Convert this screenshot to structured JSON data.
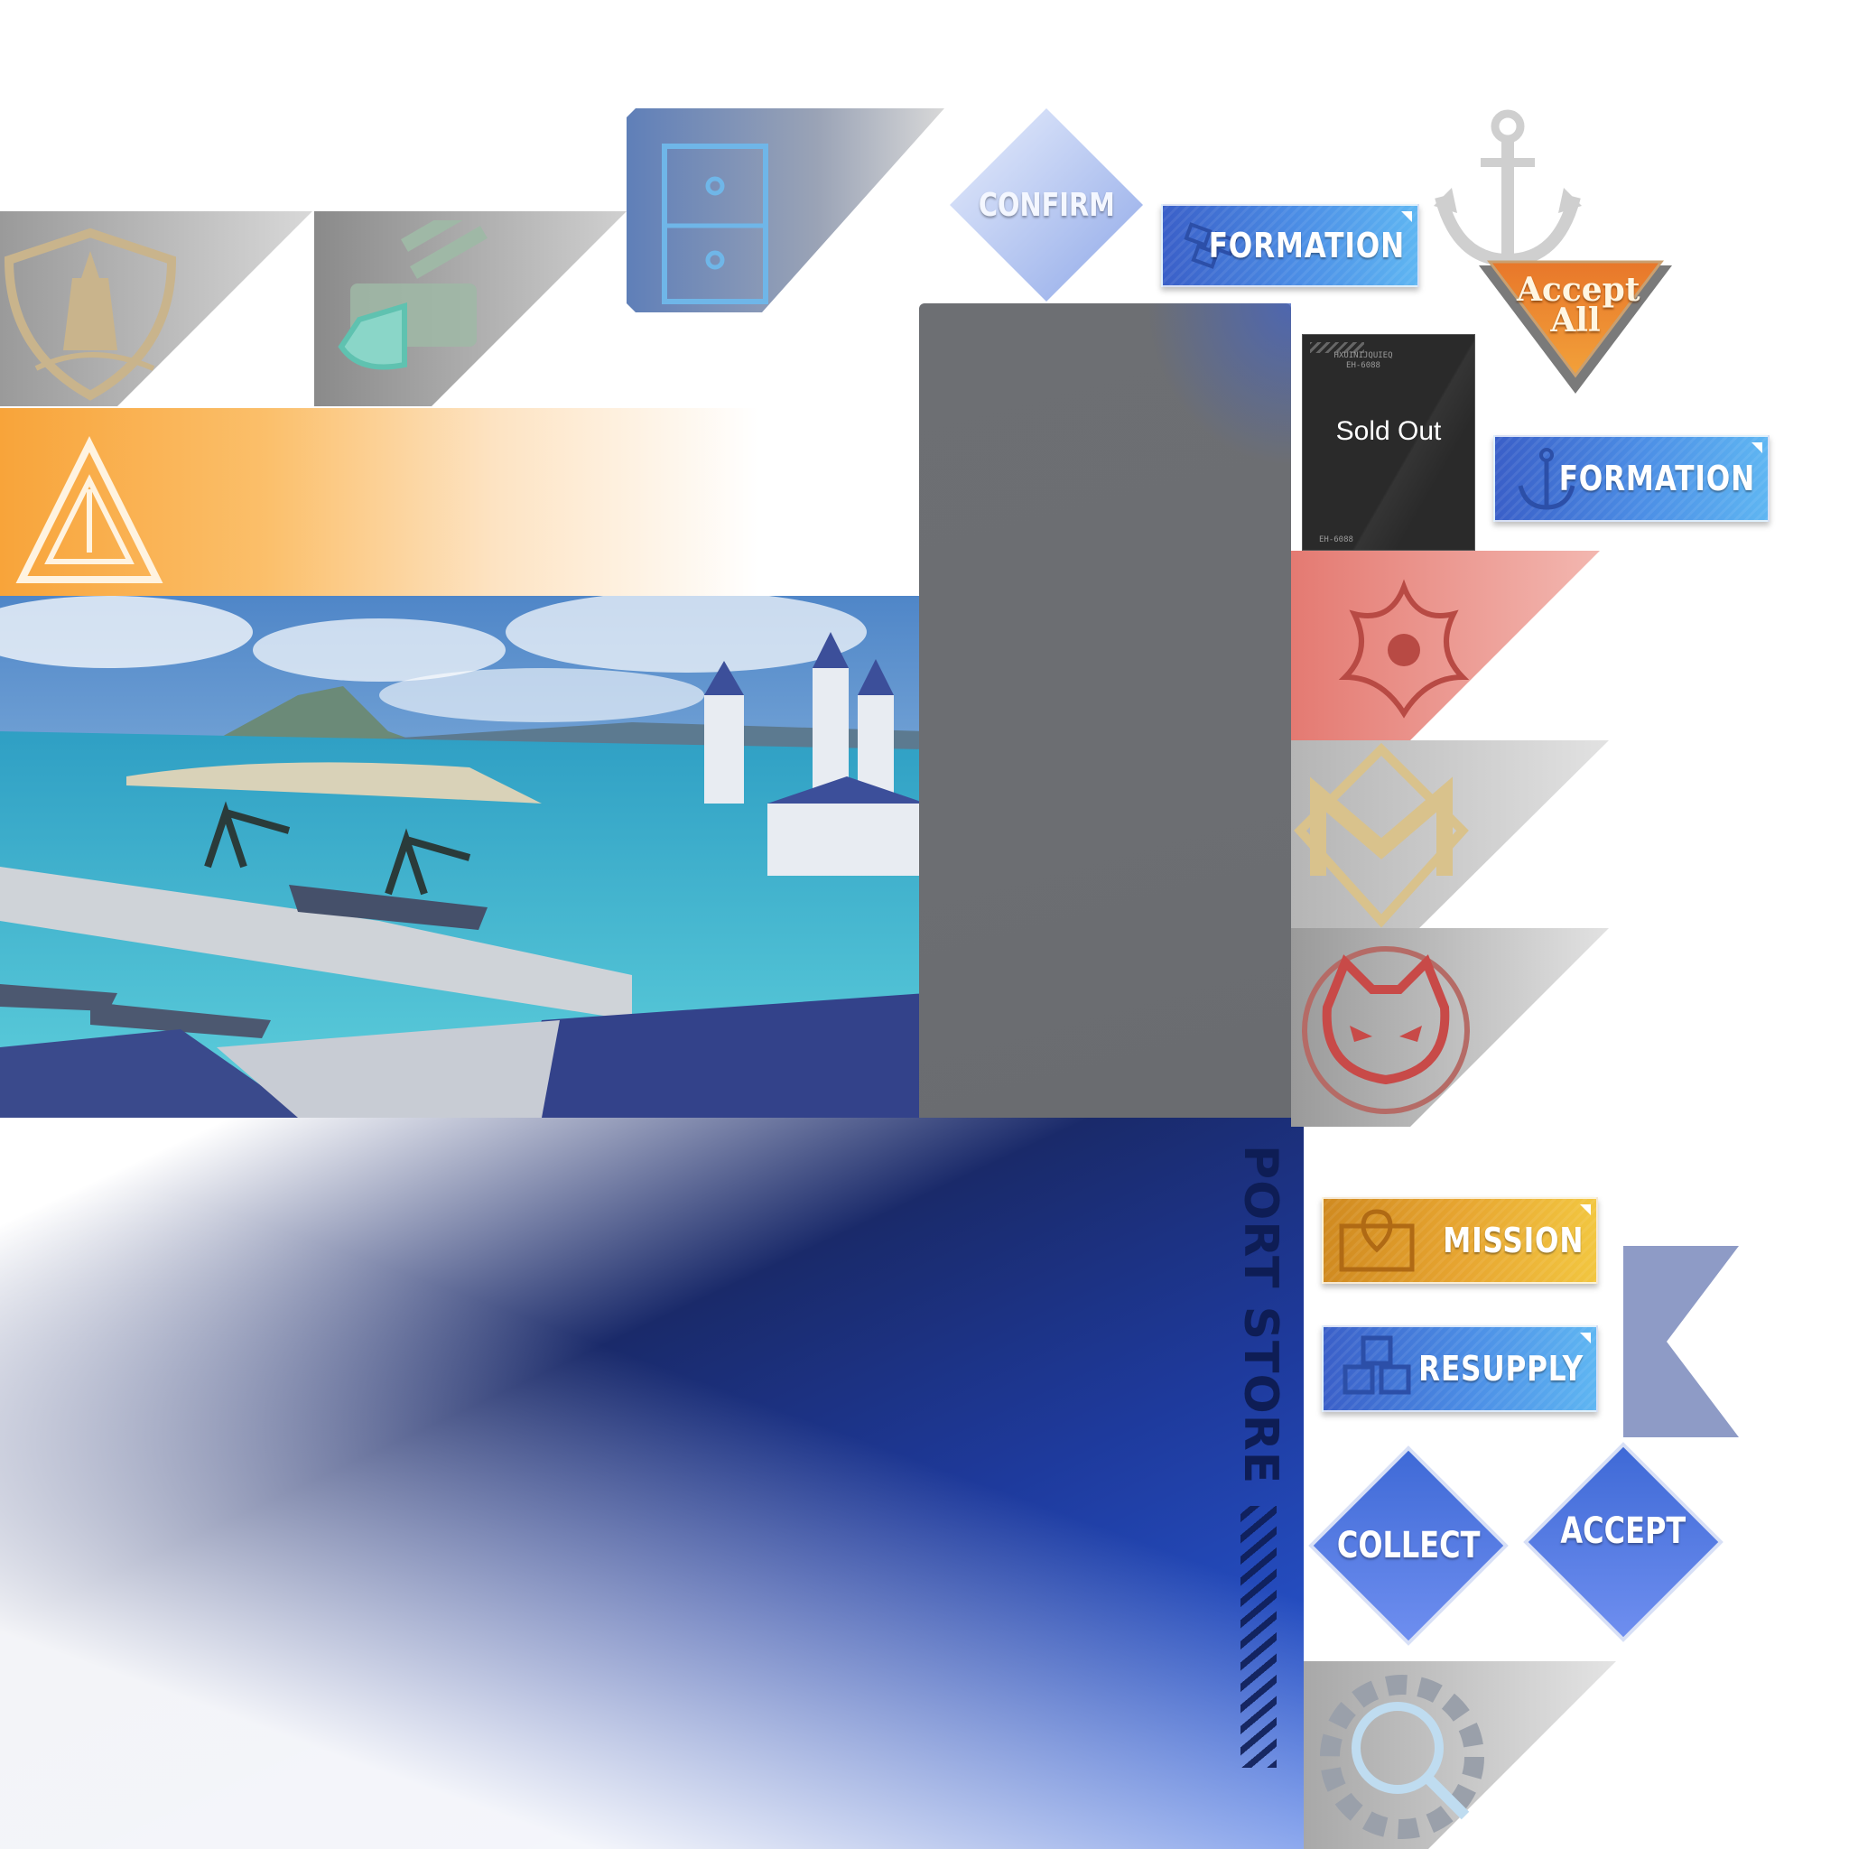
{
  "buttons": {
    "confirm": "CONFIRM",
    "formation_top": "FORMATION",
    "formation_mid": "FORMATION",
    "accept_all": "Accept All",
    "mission": "MISSION",
    "resupply": "RESUPPLY",
    "collect": "COLLECT",
    "accept": "ACCEPT"
  },
  "sold_out": {
    "label": "Sold Out",
    "code_lines": [
      "HXUINIJQUIEQ",
      "EH-6088"
    ],
    "footer_code": "EH-6088"
  },
  "port_store_banner": {
    "title": "PORT STORE"
  },
  "colors": {
    "blue_button": "#4c8fe6",
    "gold_button": "#e7a530",
    "orange_banner": "#f8a43a",
    "navy_banner": "#1a2a6a",
    "gray_panel": "#6d6f73",
    "diamond_blue": "#5a7fd8"
  },
  "icons": [
    "ship-shield-icon",
    "turret-shield-icon",
    "drawer-icon",
    "anchor-icon",
    "triangle-emblem-icon",
    "phoenix-emblem-icon",
    "m-emblem-icon",
    "cat-emblem-icon",
    "gear-search-icon",
    "map-pin-icon",
    "boxes-icon",
    "bookmark-flag-icon"
  ]
}
